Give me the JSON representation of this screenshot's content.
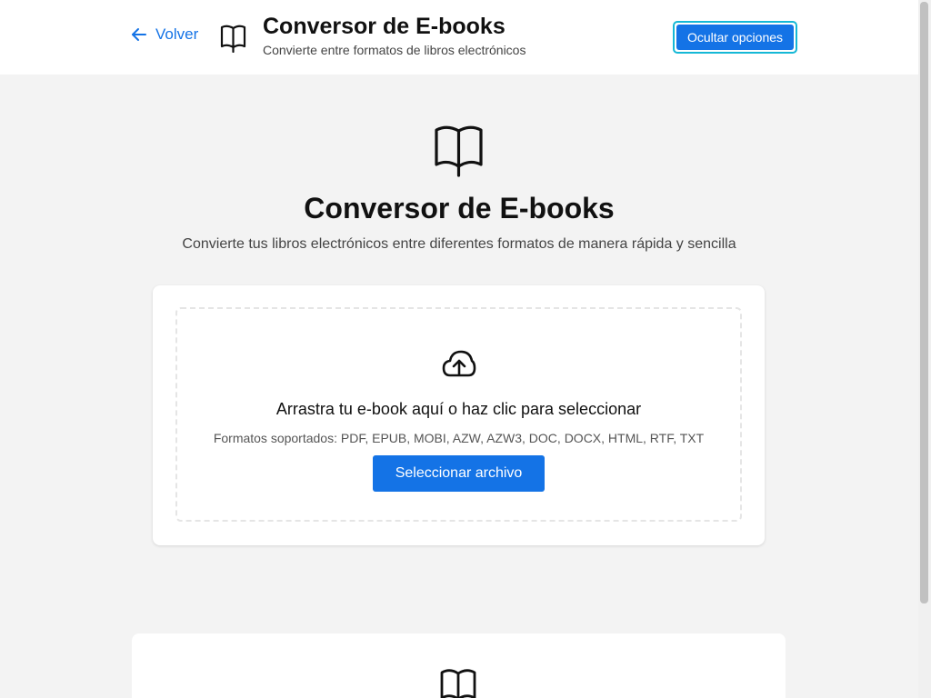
{
  "header": {
    "back_label": "Volver",
    "title": "Conversor de E-books",
    "subtitle": "Convierte entre formatos de libros electrónicos",
    "options_button": "Ocultar opciones"
  },
  "hero": {
    "title": "Conversor de E-books",
    "subtitle": "Convierte tus libros electrónicos entre diferentes formatos de manera rápida y sencilla",
    "icon": "book-open-icon"
  },
  "upload": {
    "icon": "cloud-upload-icon",
    "drop_text": "Arrastra tu e-book aquí o haz clic para seleccionar",
    "formats_text": "Formatos soportados: PDF, EPUB, MOBI, AZW, AZW3, DOC, DOCX, HTML, RTF, TXT",
    "select_button": "Seleccionar archivo"
  },
  "colors": {
    "accent": "#1473e6",
    "focus_ring": "#15b8d6",
    "background": "#f3f3f3"
  }
}
